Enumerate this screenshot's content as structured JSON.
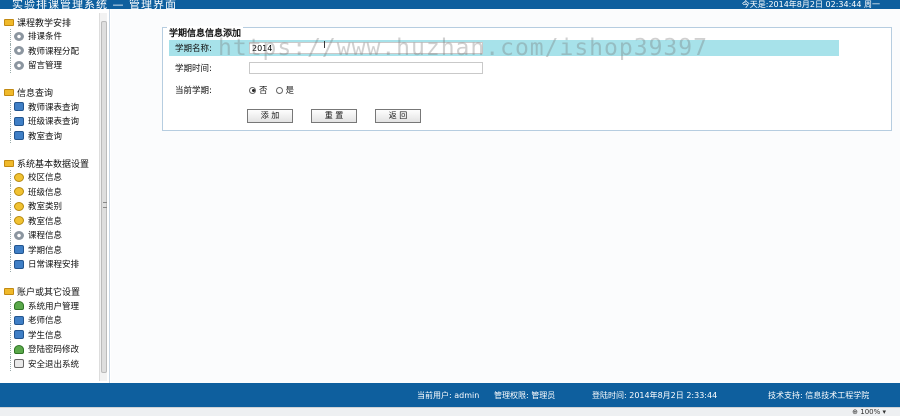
{
  "header": {
    "title": "实验排课管理系统 — 管理界面",
    "datetime": "今天是:2014年8月2日  02:34:44  周一"
  },
  "sidebar": {
    "groups": [
      {
        "label": "课程教学安排",
        "items": [
          {
            "label": "排课条件",
            "icon": "gear-icon"
          },
          {
            "label": "教师课程分配",
            "icon": "gear-icon"
          },
          {
            "label": "留言管理",
            "icon": "gear-icon"
          }
        ]
      },
      {
        "label": "信息查询",
        "items": [
          {
            "label": "教师课表查询",
            "icon": "document-icon"
          },
          {
            "label": "班级课表查询",
            "icon": "document-icon"
          },
          {
            "label": "教室查询",
            "icon": "document-icon"
          }
        ]
      },
      {
        "label": "系统基本数据设置",
        "items": [
          {
            "label": "校区信息",
            "icon": "star-icon"
          },
          {
            "label": "班级信息",
            "icon": "star-icon"
          },
          {
            "label": "教室类别",
            "icon": "star-icon"
          },
          {
            "label": "教室信息",
            "icon": "star-icon"
          },
          {
            "label": "课程信息",
            "icon": "gear-icon"
          },
          {
            "label": "学期信息",
            "icon": "document-icon"
          },
          {
            "label": "日常课程安排",
            "icon": "document-icon"
          }
        ]
      },
      {
        "label": "账户或其它设置",
        "items": [
          {
            "label": "系统用户管理",
            "icon": "users-icon"
          },
          {
            "label": "老师信息",
            "icon": "document-icon"
          },
          {
            "label": "学生信息",
            "icon": "document-icon"
          },
          {
            "label": "登陆密码修改",
            "icon": "user-icon"
          },
          {
            "label": "安全退出系统",
            "icon": "exit-icon"
          }
        ]
      }
    ]
  },
  "form": {
    "title": "学期信息信息添加",
    "term_name_label": "学期名称:",
    "term_name_value": "2014",
    "term_time_label": "学期时间:",
    "term_time_value": "",
    "current_term_label": "当前学期:",
    "option_no": "否",
    "option_yes": "是",
    "selected": "否",
    "add_button": "添 加",
    "reset_button": "重 置",
    "back_button": "返 回"
  },
  "watermark": "https://www.huzhan.com/ishop39397",
  "footer": {
    "current_user": "当前用户: admin",
    "permission": "管理权限: 管理员",
    "login_time": "登陆时间: 2014年8月2日 2:33:44",
    "support": "技术支持: 信息技术工程学院"
  },
  "statusbar": {
    "zoom": "⊕ 100%  ▾"
  }
}
